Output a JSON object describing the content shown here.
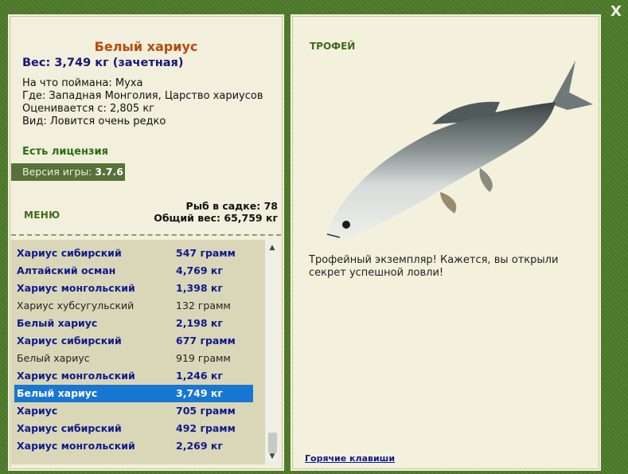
{
  "close_label": "X",
  "fish": {
    "name": "Белый хариус",
    "weight": "Вес: 3,749 кг (зачетная)",
    "caught_on": "На что поймана: Муха",
    "location": "Где: Западная Монголия, Царство хариусов",
    "value": "Оценивается с: 2,805 кг",
    "rarity": "Вид: Ловится очень редко"
  },
  "license": "Есть лицензия",
  "version": {
    "label": "Версия игры:",
    "value": "3.7.6"
  },
  "menu_label": "МЕНЮ",
  "stats": {
    "count": "Рыб в садке: 78",
    "total": "Общий вес: 65,759 кг"
  },
  "catch_list": [
    {
      "name": "Хариус сибирский",
      "weight": "547 грамм",
      "style": "bold"
    },
    {
      "name": "Алтайский осман",
      "weight": "4,769 кг",
      "style": "bold"
    },
    {
      "name": "Хариус монгольский",
      "weight": "1,398 кг",
      "style": "bold"
    },
    {
      "name": "Хариус хубсугульский",
      "weight": "132 грамм",
      "style": "norm"
    },
    {
      "name": "Белый хариус",
      "weight": "2,198 кг",
      "style": "bold"
    },
    {
      "name": "Хариус сибирский",
      "weight": "677 грамм",
      "style": "bold"
    },
    {
      "name": "Белый хариус",
      "weight": "919 грамм",
      "style": "norm"
    },
    {
      "name": "Хариус монгольский",
      "weight": "1,246 кг",
      "style": "bold"
    },
    {
      "name": "Белый хариус",
      "weight": "3,749 кг",
      "style": "sel"
    },
    {
      "name": "Хариус",
      "weight": "705 грамм",
      "style": "bold"
    },
    {
      "name": "Хариус сибирский",
      "weight": "492 грамм",
      "style": "bold"
    },
    {
      "name": "Хариус монгольский",
      "weight": "2,269 кг",
      "style": "bold"
    }
  ],
  "trophy_label": "ТРОФЕЙ",
  "description": "Трофейный экземпляр! Кажется, вы открыли секрет успешной ловли!",
  "hotkeys_label": "Горячие клавиши",
  "colors": {
    "background": "#4d7a2c",
    "panel": "#f2efdc",
    "selected": "#1877d2",
    "title": "#b74a10",
    "list_name": "#0f1a8c"
  }
}
